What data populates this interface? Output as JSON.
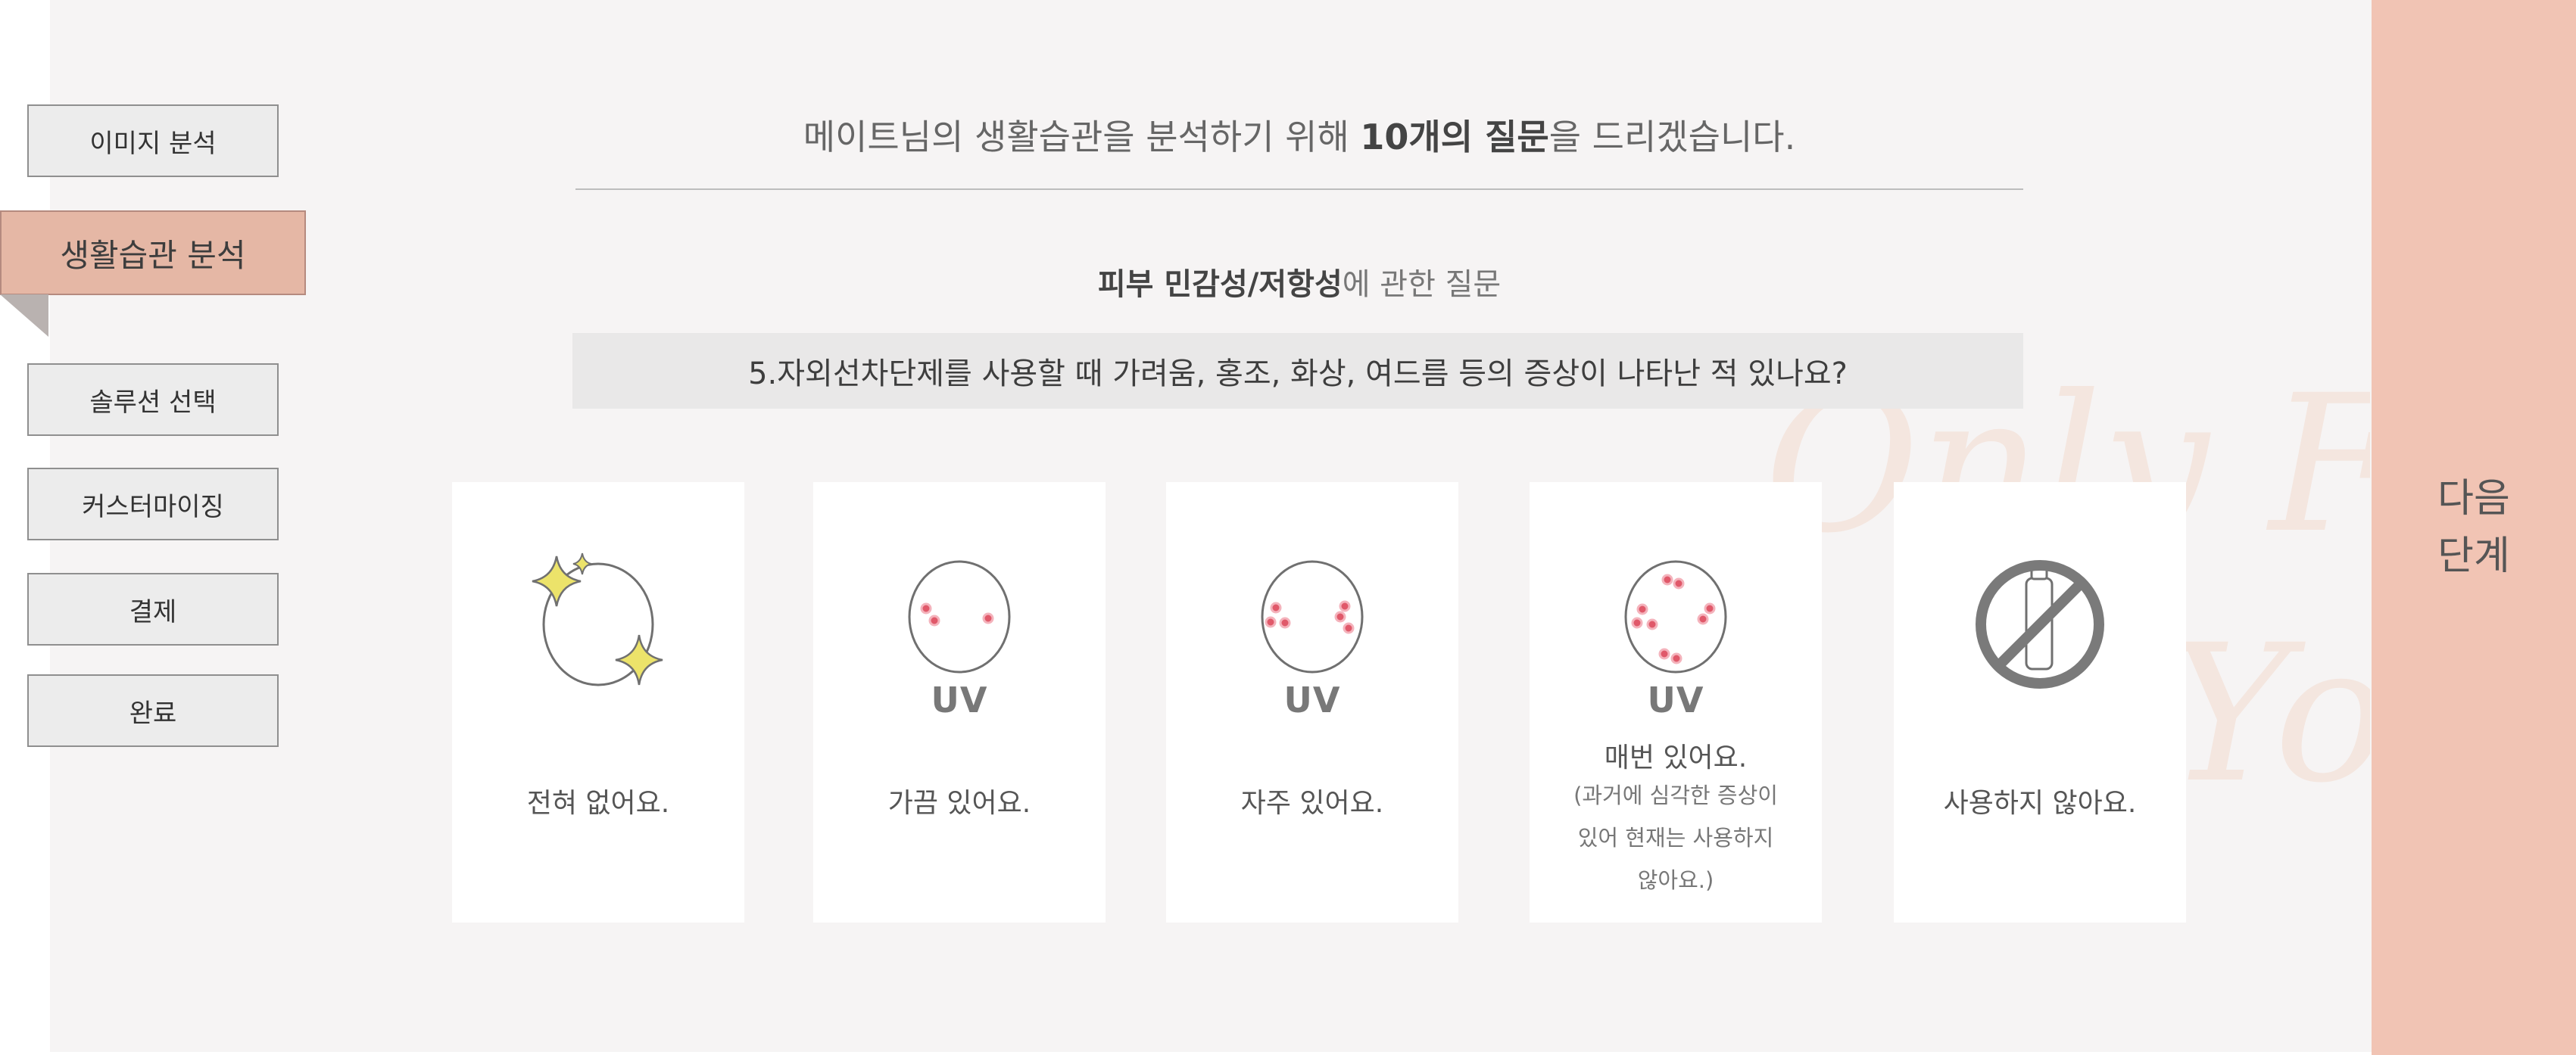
{
  "sidebar": {
    "steps": [
      {
        "label": "이미지 분석",
        "active": false
      },
      {
        "label": "생활습관 분석",
        "active": true
      },
      {
        "label": "솔루션 선택",
        "active": false
      },
      {
        "label": "커스터마이징",
        "active": false
      },
      {
        "label": "결제",
        "active": false
      },
      {
        "label": "완료",
        "active": false
      }
    ]
  },
  "header": {
    "intro_prefix": "메이트님의 생활습관을 분석하기 위해 ",
    "intro_emphasis": "10개의 질문",
    "intro_suffix": "을 드리겠습니다."
  },
  "category": {
    "topic": "피부 민감성/저항성",
    "suffix": "에 관한 질문"
  },
  "question": {
    "text": "5.자외선차단제를 사용할 때 가려움, 홍조, 화상, 여드름 등의 증상이 나타난 적 있나요?"
  },
  "options": [
    {
      "label": "전혀 없어요.",
      "icon": "sparkle-clear-face-icon"
    },
    {
      "label": "가끔 있어요.",
      "icon": "face-few-spots-icon",
      "badge": "UV"
    },
    {
      "label": "자주 있어요.",
      "icon": "face-some-spots-icon",
      "badge": "UV"
    },
    {
      "label": "매번 있어요.",
      "icon": "face-many-spots-icon",
      "badge": "UV",
      "note_lines": [
        "(과거에 심각한 증상이",
        "있어 현재는 사용하지",
        "않아요.)"
      ]
    },
    {
      "label": "사용하지 않아요.",
      "icon": "no-sunscreen-icon"
    }
  ],
  "next_button": {
    "line1": "다음",
    "line2": "단계"
  },
  "watermark": {
    "line1": "Only For",
    "line2": "You"
  },
  "colors": {
    "accent": "#e5b7a5",
    "next_button_bg": "#f1c4b4",
    "panel_bg": "#f6f4f4",
    "sparkle": "#ece36a",
    "spot": "#e0596a"
  }
}
